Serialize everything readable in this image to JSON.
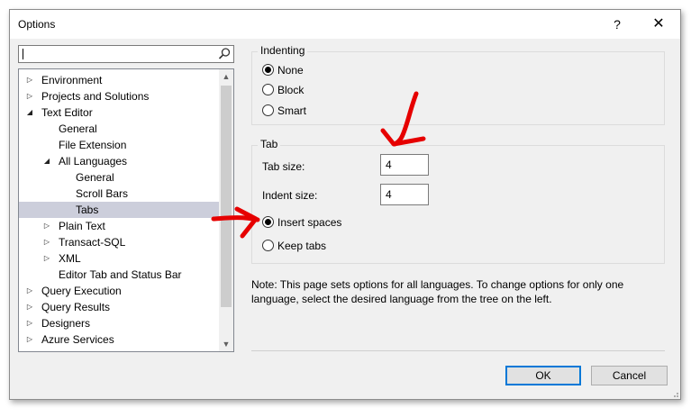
{
  "window": {
    "title": "Options",
    "help_glyph": "?",
    "close_glyph": "✕"
  },
  "search": {
    "value": "",
    "icon": "search-icon"
  },
  "tree": {
    "items": [
      {
        "label": "Environment",
        "arrow": "▷"
      },
      {
        "label": "Projects and Solutions",
        "arrow": "▷"
      },
      {
        "label": "Text Editor",
        "arrow": "◢"
      },
      {
        "label": "General",
        "arrow": ""
      },
      {
        "label": "File Extension",
        "arrow": ""
      },
      {
        "label": "All Languages",
        "arrow": "◢"
      },
      {
        "label": "General",
        "arrow": ""
      },
      {
        "label": "Scroll Bars",
        "arrow": ""
      },
      {
        "label": "Tabs",
        "arrow": "",
        "selected": true
      },
      {
        "label": "Plain Text",
        "arrow": "▷"
      },
      {
        "label": "Transact-SQL",
        "arrow": "▷"
      },
      {
        "label": "XML",
        "arrow": "▷"
      },
      {
        "label": "Editor Tab and Status Bar",
        "arrow": ""
      },
      {
        "label": "Query Execution",
        "arrow": "▷"
      },
      {
        "label": "Query Results",
        "arrow": "▷"
      },
      {
        "label": "Designers",
        "arrow": "▷"
      },
      {
        "label": "Azure Services",
        "arrow": "▷"
      }
    ],
    "scroll_up": "▲",
    "scroll_down": "▼"
  },
  "indenting": {
    "title": "Indenting",
    "options": [
      {
        "label": "None",
        "checked": true
      },
      {
        "label": "Block",
        "checked": false
      },
      {
        "label": "Smart",
        "checked": false
      }
    ]
  },
  "tab": {
    "title": "Tab",
    "tab_size_label": "Tab size:",
    "tab_size_value": "4",
    "indent_size_label": "Indent size:",
    "indent_size_value": "4",
    "options": [
      {
        "label": "Insert spaces",
        "checked": true
      },
      {
        "label": "Keep tabs",
        "checked": false
      }
    ]
  },
  "note": "Note: This page sets options for all languages. To change options for only one language, select the desired language from the tree on the left.",
  "buttons": {
    "ok": "OK",
    "cancel": "Cancel"
  },
  "colors": {
    "selection": "#cccedb",
    "accent": "#0078d7",
    "annotation": "#e60000"
  }
}
